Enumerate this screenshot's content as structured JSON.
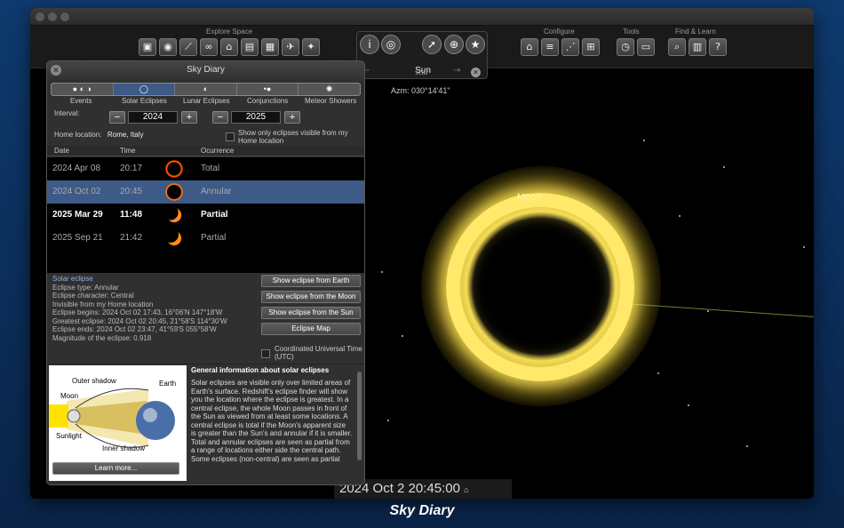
{
  "caption": "Sky Diary",
  "toolbar": {
    "explore_space_label": "Explore Space",
    "configure_label": "Configure",
    "tools_label": "Tools",
    "find_learn_label": "Find & Learn"
  },
  "object_panel": {
    "name": "Sun",
    "type": "star",
    "azimuth": "Azm: 030°14'41\""
  },
  "sky": {
    "moon_label": "Moon"
  },
  "time_display": "2024  Oct  2  20:45:00",
  "dialog": {
    "title": "Sky Diary",
    "tabs": [
      "Events",
      "Solar Eclipses",
      "Lunar Eclipses",
      "Conjunctions",
      "Meteor Showers"
    ],
    "active_tab": "Solar Eclipses",
    "interval_label": "Interval:",
    "interval_start": "2024",
    "interval_end": "2025",
    "home_location_label": "Home location:",
    "home_location": "Rome, Italy",
    "only_visible_label": "Show only eclipses visible from my Home location",
    "columns": [
      "Date",
      "Time",
      "Ocurrence"
    ],
    "rows": [
      {
        "date": "2024 Apr 08",
        "time": "20:17",
        "occurrence": "Total"
      },
      {
        "date": "2024 Oct 02",
        "time": "20:45",
        "occurrence": "Annular"
      },
      {
        "date": "2025 Mar 29",
        "time": "11:48",
        "occurrence": "Partial"
      },
      {
        "date": "2025 Sep 21",
        "time": "21:42",
        "occurrence": "Partial"
      }
    ],
    "info": {
      "heading": "Solar eclipse",
      "type": "Eclipse type: Annular",
      "character": "Eclipse character: Central",
      "visibility": "Invisible from my Home location",
      "begins": "Eclipse begins: 2024 Oct 02 17:43,  16°06'N 147°18'W",
      "greatest": "Greatest eclipse: 2024 Oct 02 20:45,  21°58'S 114°30'W",
      "ends": "Eclipse ends: 2024 Oct 02 23:47,  41°59'S 055°58'W",
      "magnitude": "Magnitude of the eclipse:  0.918"
    },
    "buttons": {
      "from_earth": "Show eclipse from Earth",
      "from_moon": "Show eclipse from the Moon",
      "from_sun": "Show eclipse from the Sun",
      "map": "Eclipse Map"
    },
    "utc_label": "Coordinated Universal Time (UTC)",
    "diagram": {
      "outer_shadow": "Outer shadow",
      "earth": "Earth",
      "moon": "Moon",
      "sunlight": "Sunlight",
      "inner_shadow": "Inner shadow"
    },
    "learn_more": "Learn more...",
    "general_title": "General information about solar eclipses",
    "general_text": "Solar eclipses are visible only over limited areas of Earth's surface. Redshift's eclipse finder will show you the location where the eclipse is greatest. In a central eclipse, the whole Moon passes in front of the Sun as viewed from at least some locations. A central eclipse is total if the Moon's apparent size is greater than the Sun's and annular if it is smaller. Total and annular eclipses are seen as partial from a range of locations either side the central path. Some eclipses (non-central) are seen as partial"
  }
}
